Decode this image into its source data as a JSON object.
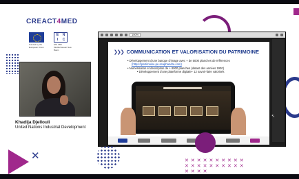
{
  "branding": {
    "title_part1": "CREACT",
    "title_accent": "4",
    "title_part2": "MED",
    "eu_caption": "Funded by the European Union",
    "enicbc_letters": [
      "E",
      "N",
      "I",
      "C"
    ],
    "enicbc_caption": "ENI CBC Mediterranean Sea Basin"
  },
  "speaker": {
    "name": "Khadija Djellouli",
    "organization": "United Nations Industrial Development"
  },
  "viewer": {
    "zoom": "100%"
  },
  "slide": {
    "chevrons": "❯❯❯",
    "title": "COMMUNICATION ET VALORISATION DU PATRIMOINE",
    "bullet_1": "• Développement d'une banque d'image avec + de 5000 planches de références",
    "bullet_1_link": "(https://patrimoine.pe.scaphandra.com)",
    "bullet_2": "• Numérisation et description de + 6000 planches (datant des années 1930)",
    "bullet_3": "• Développement d'une plateforme digitale+ 12 savoir-faire valorisés"
  },
  "decor": {
    "x_mark": "✕",
    "x_grid": "✕✕✕✕✕✕✕✕✕✕✕✕✕✕✕✕✕✕✕✕✕✕✕✕",
    "colors": {
      "brand_blue": "#2a3a8c",
      "brand_magenta": "#a0288c",
      "title_blue": "#1d3a8c"
    }
  }
}
